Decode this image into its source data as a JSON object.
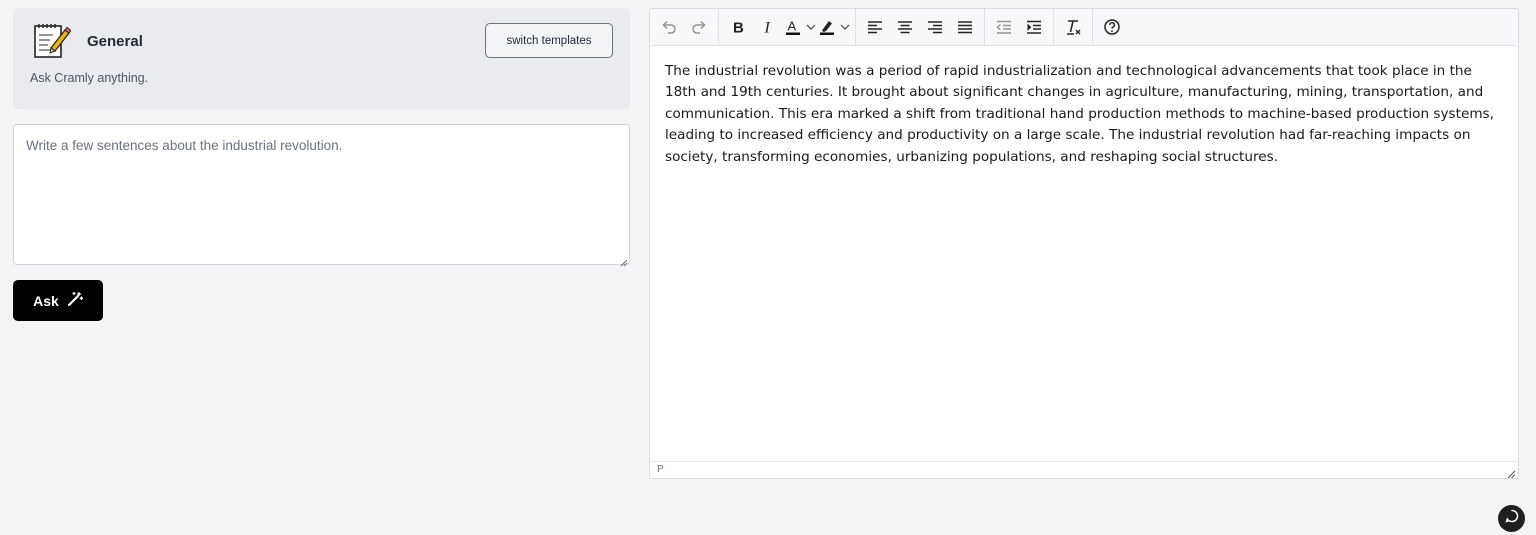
{
  "template": {
    "title": "General",
    "description": "Ask Cramly anything.",
    "switch_label": "switch templates",
    "icon": "memo-pencil-icon"
  },
  "prompt": {
    "placeholder": "Write a few sentences about the industrial revolution."
  },
  "ask_button": {
    "label": "Ask",
    "icon": "magic-wand-icon"
  },
  "editor": {
    "toolbar": [
      "undo-icon",
      "redo-icon",
      "bold-icon",
      "italic-icon",
      "text-color-icon",
      "highlight-color-icon",
      "align-left-icon",
      "align-center-icon",
      "align-right-icon",
      "align-justify-icon",
      "outdent-icon",
      "indent-icon",
      "clear-formatting-icon",
      "help-icon"
    ],
    "content": "The industrial revolution was a period of rapid industrialization and technological advancements that took place in the 18th and 19th centuries. It brought about significant changes in agriculture, manufacturing, mining, transportation, and communication. This era marked a shift from traditional hand production methods to machine-based production systems, leading to increased efficiency and productivity on a large scale. The industrial revolution had far-reaching impacts on society, transforming economies, urbanizing populations, and reshaping social structures.",
    "status_path": "P"
  },
  "colors": {
    "background": "#f3f4f6",
    "card": "#e9ebee",
    "ask_button": "#000000",
    "text_color_swatch": "#111111"
  }
}
